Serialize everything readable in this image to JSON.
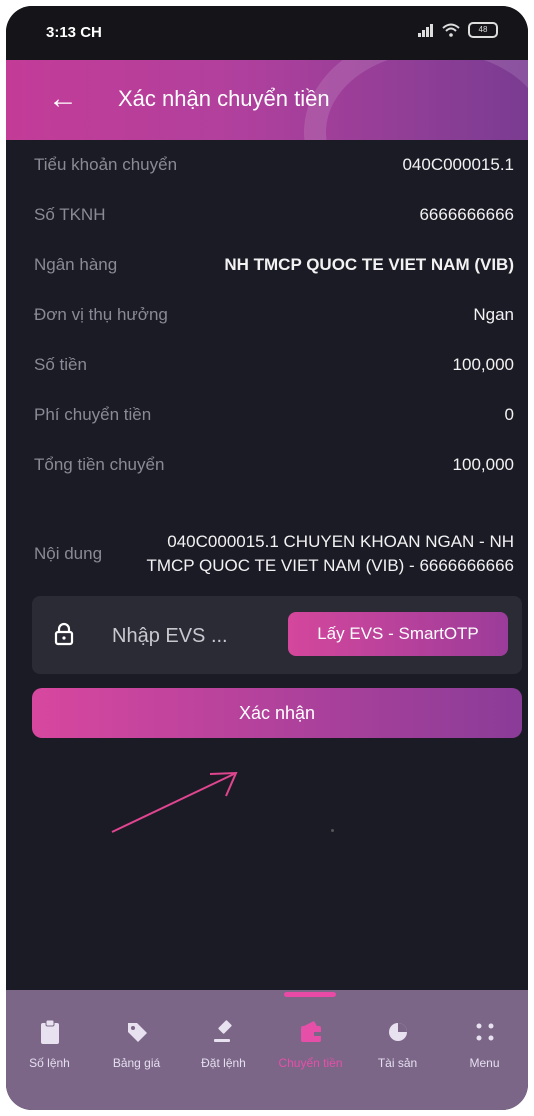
{
  "status_bar": {
    "time": "3:13 CH",
    "battery": "48"
  },
  "header": {
    "title": "Xác nhận chuyển tiền"
  },
  "details": [
    {
      "label": "Tiểu khoản chuyển",
      "value": "040C000015.1"
    },
    {
      "label": "Số TKNH",
      "value": "6666666666"
    },
    {
      "label": "Ngân hàng",
      "value": "NH TMCP QUOC TE VIET NAM (VIB)"
    },
    {
      "label": "Đơn vị thụ hưởng",
      "value": "Ngan"
    },
    {
      "label": "Số tiền",
      "value": "100,000"
    },
    {
      "label": "Phí chuyển tiền",
      "value": "0"
    },
    {
      "label": "Tổng tiền chuyển",
      "value": "100,000"
    }
  ],
  "content": {
    "label": "Nội dung",
    "value": "040C000015.1 CHUYEN KHOAN NGAN - NH TMCP QUOC TE VIET NAM (VIB) - 6666666666"
  },
  "otp": {
    "placeholder": "Nhập EVS ...",
    "button_label": "Lấy EVS - SmartOTP"
  },
  "confirm_label": "Xác nhận",
  "nav": [
    {
      "label": "Số lệnh",
      "icon": "clipboard-icon"
    },
    {
      "label": "Bảng giá",
      "icon": "tag-icon"
    },
    {
      "label": "Đặt lệnh",
      "icon": "gavel-icon"
    },
    {
      "label": "Chuyển tiền",
      "icon": "wallet-icon",
      "active": true
    },
    {
      "label": "Tài sản",
      "icon": "chart-pie-icon"
    },
    {
      "label": "Menu",
      "icon": "grid-dots-icon"
    }
  ],
  "colors": {
    "accent": "#d4479c",
    "background": "#1b1b26",
    "nav_active": "#e64fa8"
  }
}
